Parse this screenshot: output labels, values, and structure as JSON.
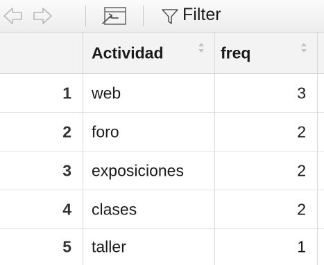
{
  "toolbar": {
    "back_icon": "arrow-left-icon",
    "forward_icon": "arrow-right-icon",
    "popout_icon": "show-in-window-icon",
    "filter_icon": "funnel-icon",
    "filter_label": "Filter"
  },
  "table": {
    "columns": [
      "",
      "Actividad",
      "freq"
    ],
    "rows": [
      {
        "index": "1",
        "actividad": "web",
        "freq": "3"
      },
      {
        "index": "2",
        "actividad": "foro",
        "freq": "2"
      },
      {
        "index": "3",
        "actividad": "exposiciones",
        "freq": "2"
      },
      {
        "index": "4",
        "actividad": "clases",
        "freq": "2"
      },
      {
        "index": "5",
        "actividad": "taller",
        "freq": "1"
      }
    ]
  },
  "colors": {
    "header_bg": "#f3f3f3",
    "toolbar_bg": "#efefef",
    "grid_line": "#d9d9d9"
  }
}
